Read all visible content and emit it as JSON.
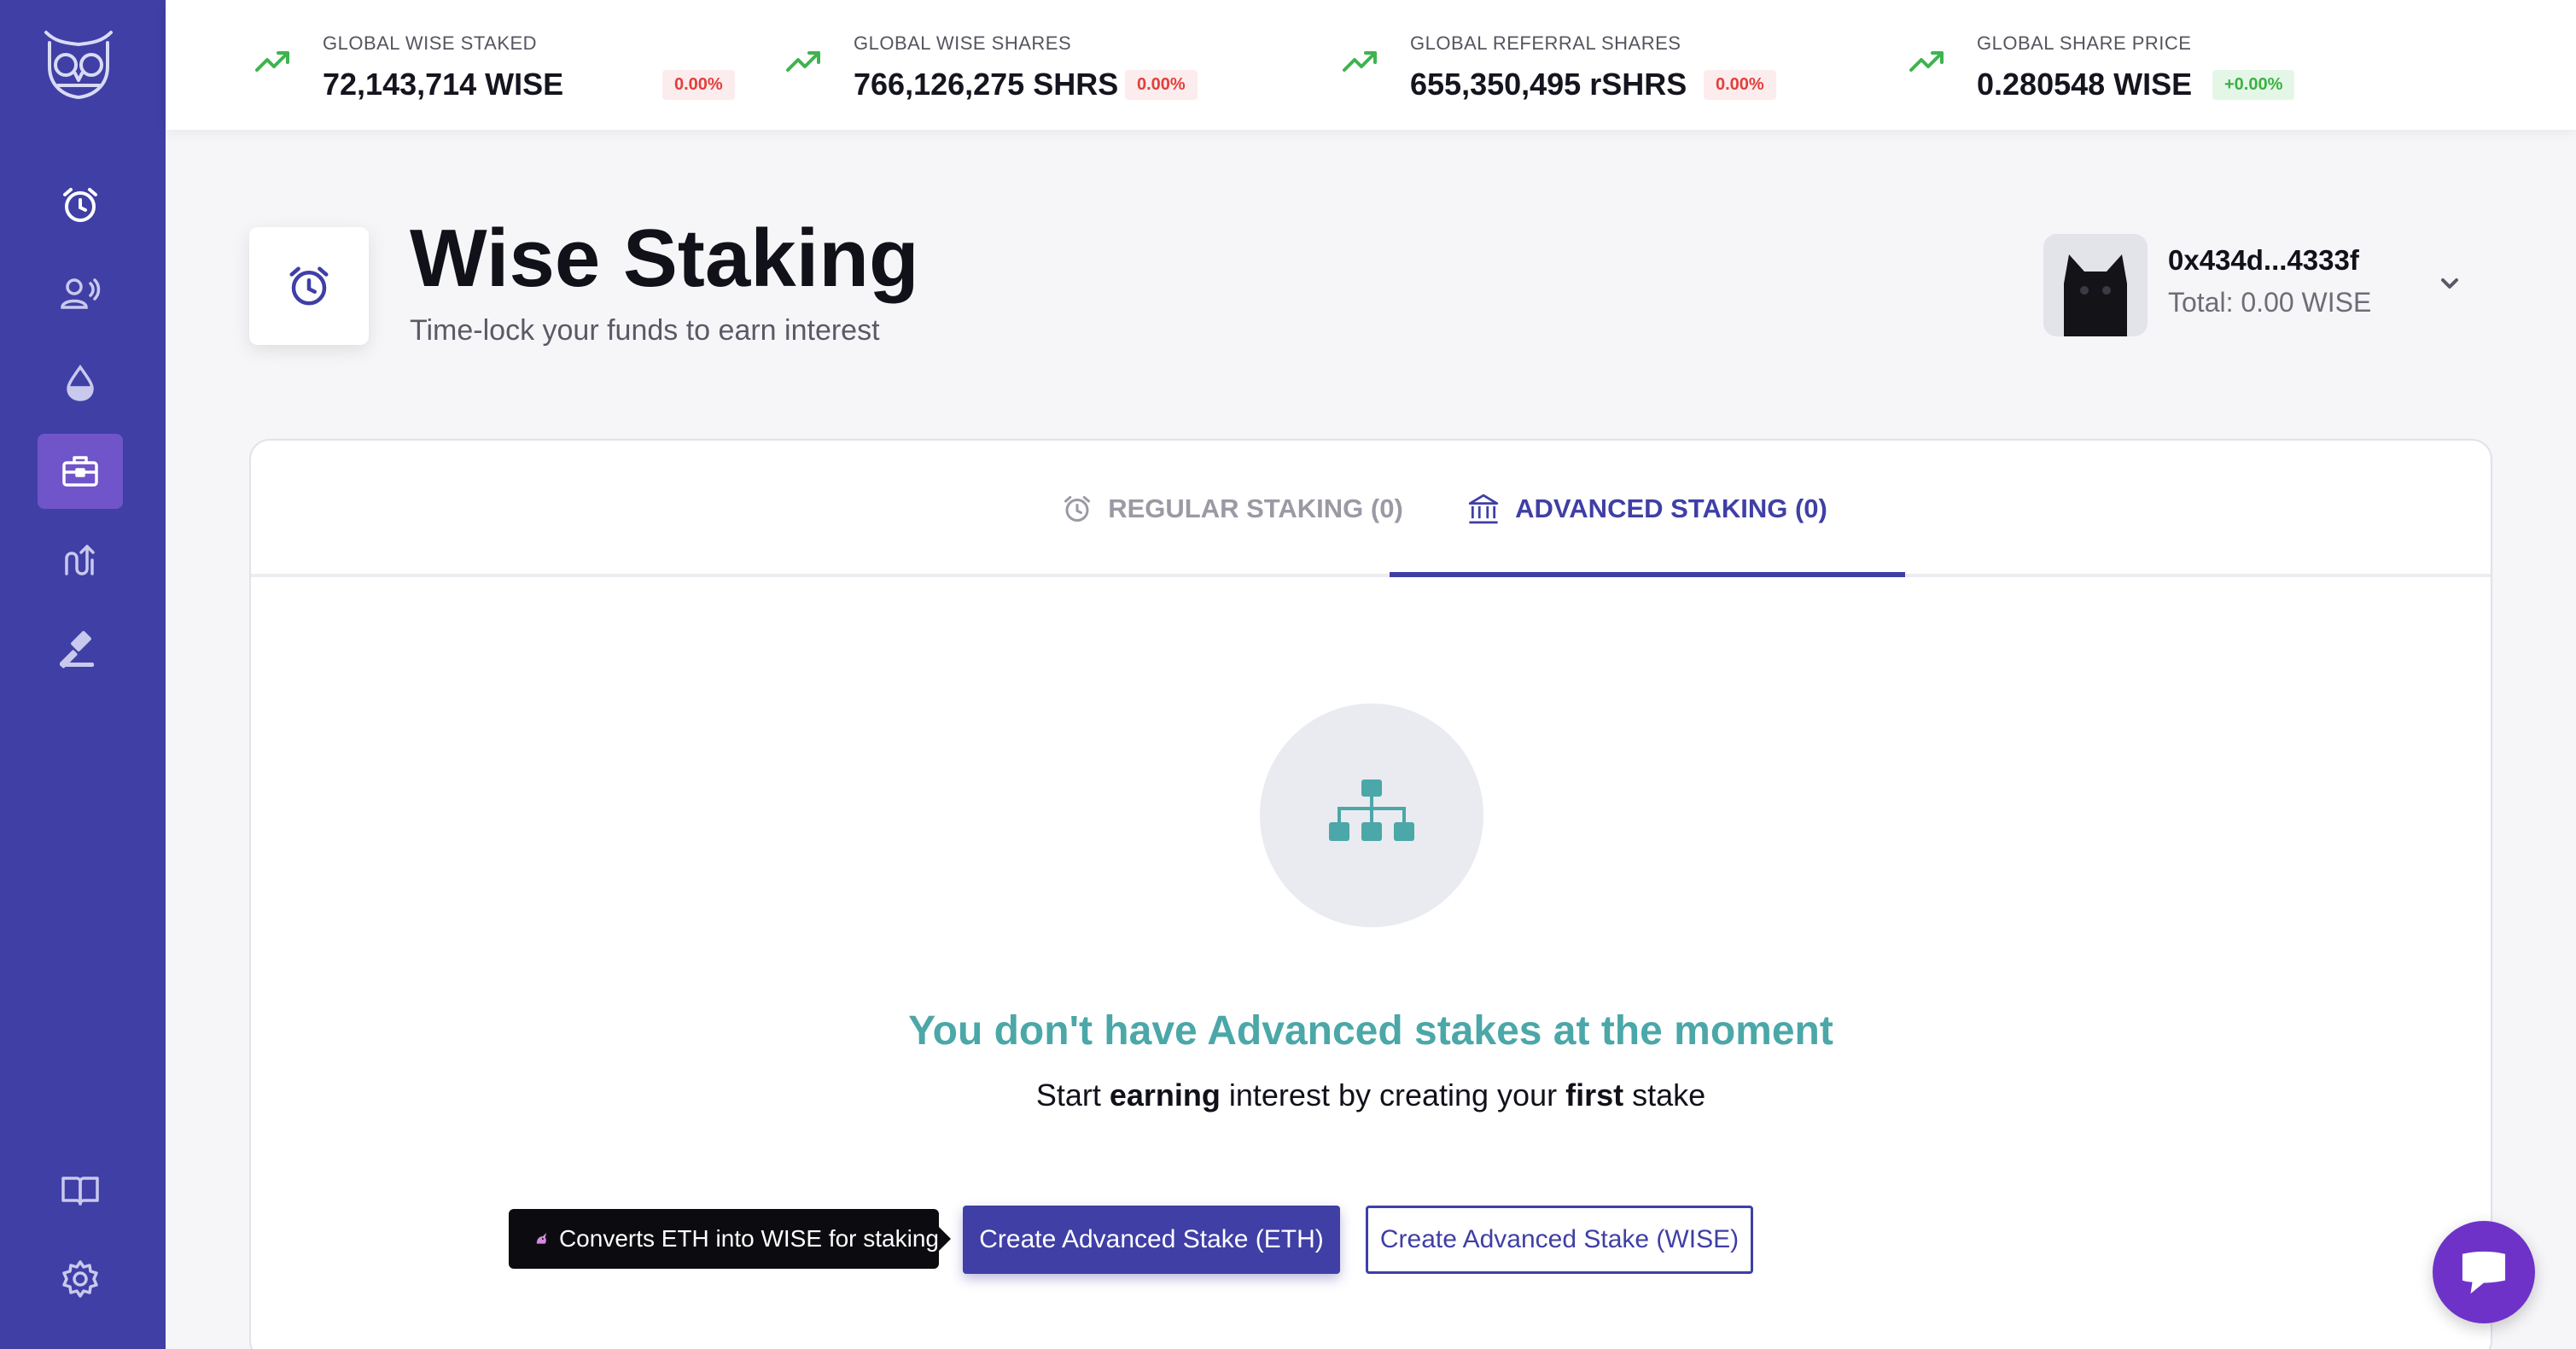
{
  "sidebar": {
    "items": [
      {
        "icon": "alarm-clock-icon"
      },
      {
        "icon": "referral-icon"
      },
      {
        "icon": "liquidity-drop-icon"
      },
      {
        "icon": "toolbox-icon",
        "active": true
      },
      {
        "icon": "swap-arrows-icon"
      },
      {
        "icon": "gavel-icon"
      },
      {
        "icon": "book-icon"
      },
      {
        "icon": "gear-icon"
      }
    ]
  },
  "stats": [
    {
      "label": "GLOBAL WISE STAKED",
      "value": "72,143,714 WISE",
      "change": "0.00%",
      "change_color": "red"
    },
    {
      "label": "GLOBAL WISE SHARES",
      "value": "766,126,275 SHRS",
      "change": "0.00%",
      "change_color": "red"
    },
    {
      "label": "GLOBAL REFERRAL SHARES",
      "value": "655,350,495 rSHRS",
      "change": "0.00%",
      "change_color": "red"
    },
    {
      "label": "GLOBAL SHARE PRICE",
      "value": "0.280548 WISE",
      "change": "+0.00%",
      "change_color": "green"
    }
  ],
  "header": {
    "title": "Wise Staking",
    "subtitle": "Time-lock your funds to earn interest"
  },
  "account": {
    "address": "0x434d...4333f",
    "total": "Total: 0.00 WISE"
  },
  "tabs": [
    {
      "label": "REGULAR STAKING (0)",
      "icon": "alarm-clock-icon",
      "active": false
    },
    {
      "label": "ADVANCED STAKING (0)",
      "icon": "bank-icon",
      "active": true
    }
  ],
  "empty_state": {
    "title": "You don't have Advanced stakes at the moment",
    "sub_1": "Start ",
    "sub_bold_1": "earning",
    "sub_2": " interest by creating your ",
    "sub_bold_2": "first",
    "sub_3": " stake"
  },
  "tooltip": {
    "text": "Converts ETH into WISE for staking"
  },
  "buttons": {
    "create_eth": "Create Advanced Stake (ETH)",
    "create_wise": "Create Advanced Stake (WISE)"
  },
  "colors": {
    "brand": "#3f3fa6",
    "accent_teal": "#4ba7a8",
    "negative": "#e0403c",
    "positive": "#3cb046",
    "chat": "#6e32c9"
  }
}
